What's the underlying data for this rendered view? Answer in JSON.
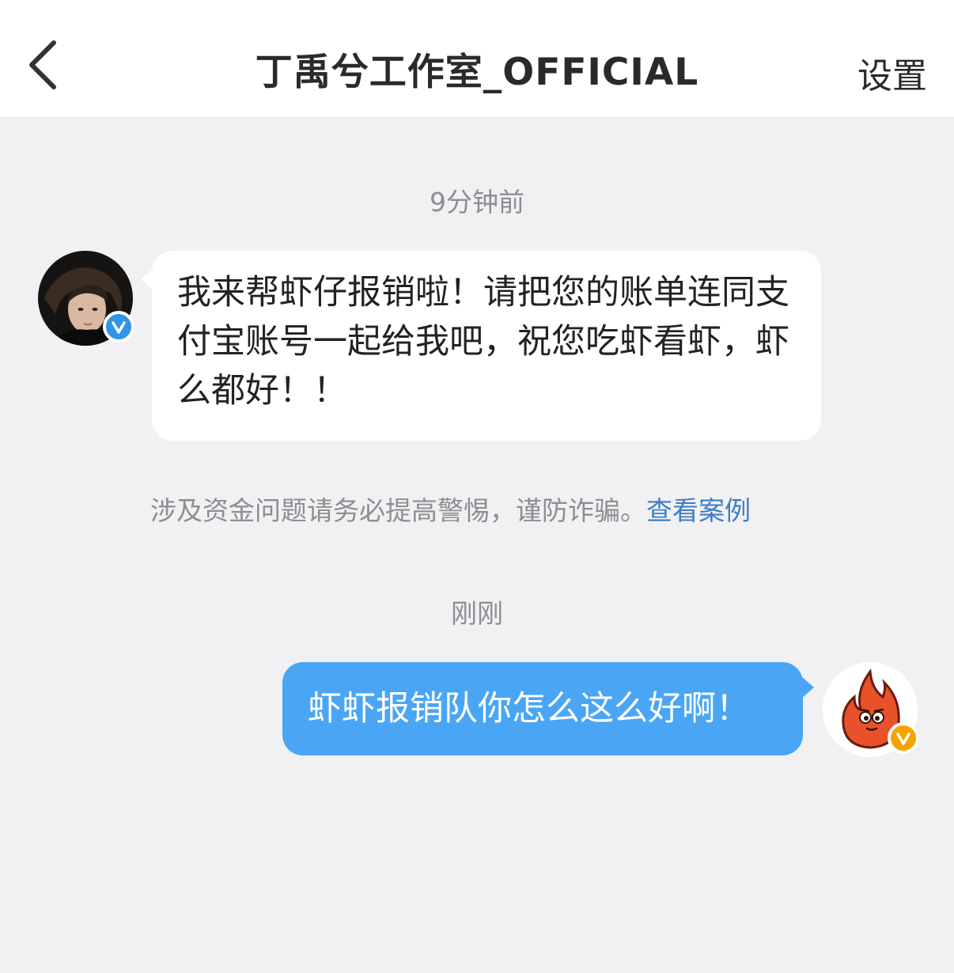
{
  "header": {
    "title": "丁禹兮工作室_OFFICIAL",
    "settings_label": "设置",
    "back_icon": "chevron-left-icon"
  },
  "messages": [
    {
      "timestamp": "9分钟前",
      "sender": "other",
      "avatar": "studio-portrait-avatar",
      "badge": "verified-blue-v",
      "text": "我来帮虾仔报销啦！请把您的账单连同支付宝账号一起给我吧，祝您吃虾看虾，虾么都好！！"
    },
    {
      "timestamp": "刚刚",
      "sender": "self",
      "avatar": "flame-mascot-avatar",
      "badge": "verified-gold-v",
      "text": "虾虾报销队你怎么这么好啊！"
    }
  ],
  "notice": {
    "text": "涉及资金问题请务必提高警惕，谨防诈骗。",
    "link_label": "查看案例"
  },
  "colors": {
    "background": "#f1f1f3",
    "outgoing_bubble": "#4aa6f4",
    "link": "#3d7dc3",
    "verified_blue": "#2e95e8",
    "verified_gold": "#f6a300"
  }
}
